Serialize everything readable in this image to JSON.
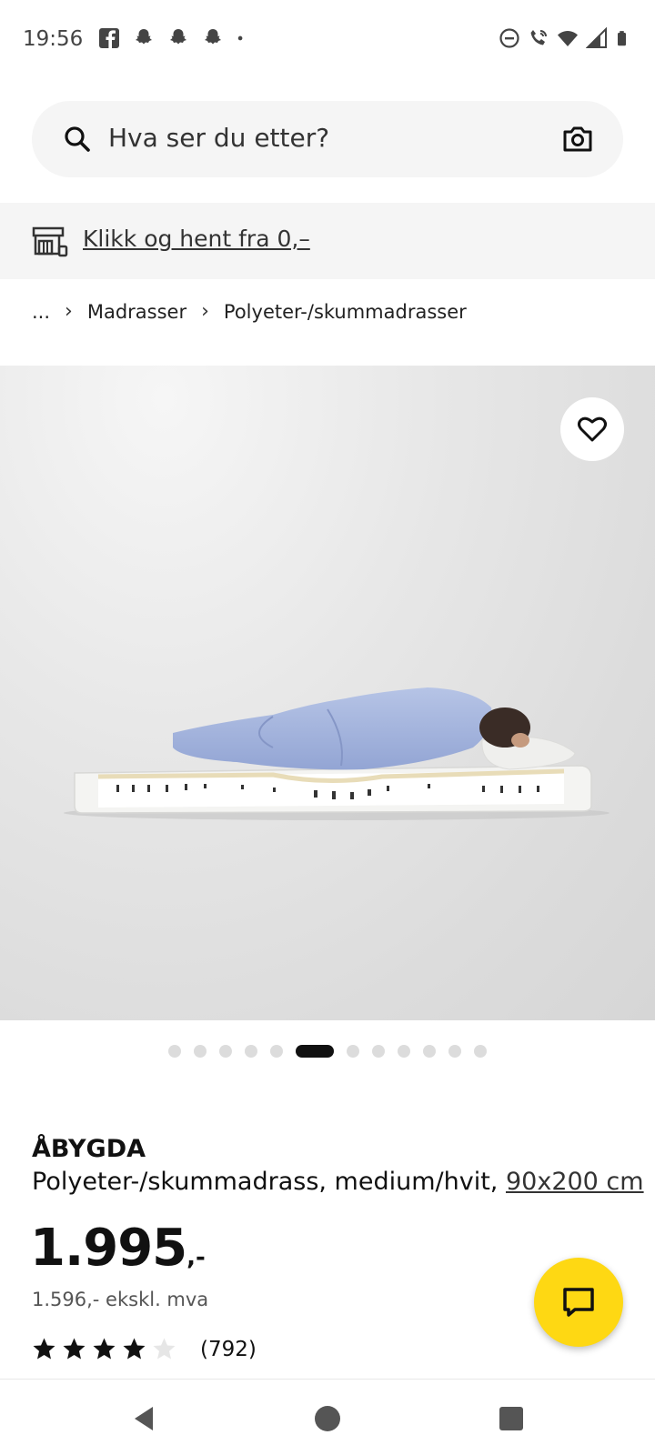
{
  "status_bar": {
    "time": "19:56",
    "left_icons": [
      "facebook-icon",
      "snapchat-icon",
      "snapchat-icon",
      "snapchat-icon",
      "dot-icon"
    ],
    "right_icons": [
      "dnd-icon",
      "wifi-calling-icon",
      "wifi-icon",
      "signal-icon",
      "battery-icon"
    ]
  },
  "search": {
    "placeholder": "Hva ser du etter?"
  },
  "promo": {
    "link_text": "Klikk og hent fra 0,–"
  },
  "breadcrumb": {
    "items": [
      "...",
      "Madrasser",
      "Polyeter-/skummadrasser"
    ]
  },
  "gallery": {
    "total_images": 12,
    "active_index": 5
  },
  "product": {
    "name": "ÅBYGDA",
    "description": "Polyeter-/skummadrass, medium/hvit,",
    "size": "90x200 cm",
    "price_main": "1.995",
    "price_suffix": ",-",
    "price_ex_vat": "1.596,- ekskl. mva",
    "rating": 4,
    "rating_max": 5,
    "review_count": "(792)"
  },
  "colors": {
    "accent_yellow": "#fed813",
    "text_dark": "#111111",
    "surface_grey": "#f5f5f5"
  }
}
